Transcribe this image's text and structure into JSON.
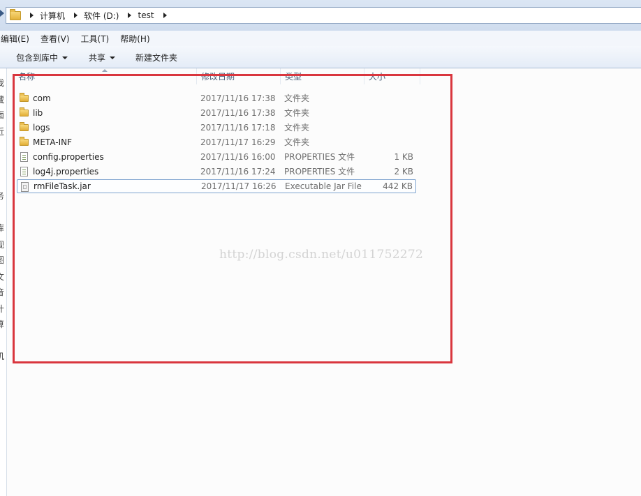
{
  "address": {
    "crumbs": [
      "计算机",
      "软件 (D:)",
      "test"
    ]
  },
  "menu": [
    "编辑(E)",
    "查看(V)",
    "工具(T)",
    "帮助(H)"
  ],
  "toolbar": {
    "include_library": "包含到库中",
    "share": "共享",
    "new_folder": "新建文件夹"
  },
  "left_pane_glyphs": [
    "我",
    "藏",
    "面",
    "近",
    "务",
    "库",
    "视",
    "图",
    "文",
    "音",
    "计",
    "算",
    "机"
  ],
  "columns": {
    "name": "名称",
    "date": "修改日期",
    "type": "类型",
    "size": "大小"
  },
  "files": [
    {
      "name": "com",
      "date": "2017/11/16 17:38",
      "type": "文件夹",
      "size": "",
      "icon": "folder-icon"
    },
    {
      "name": "lib",
      "date": "2017/11/16 17:38",
      "type": "文件夹",
      "size": "",
      "icon": "folder-icon"
    },
    {
      "name": "logs",
      "date": "2017/11/16 17:18",
      "type": "文件夹",
      "size": "",
      "icon": "folder-icon"
    },
    {
      "name": "META-INF",
      "date": "2017/11/17 16:29",
      "type": "文件夹",
      "size": "",
      "icon": "folder-icon"
    },
    {
      "name": "config.properties",
      "date": "2017/11/16 16:00",
      "type": "PROPERTIES 文件",
      "size": "1 KB",
      "icon": "properties-file-icon"
    },
    {
      "name": "log4j.properties",
      "date": "2017/11/16 17:24",
      "type": "PROPERTIES 文件",
      "size": "2 KB",
      "icon": "properties-file-icon"
    },
    {
      "name": "rmFileTask.jar",
      "date": "2017/11/17 16:26",
      "type": "Executable Jar File",
      "size": "442 KB",
      "icon": "jar-file-icon"
    }
  ],
  "watermark": "http://blog.csdn.net/u011752272",
  "colors": {
    "highlight": "#d9363e",
    "selection_border": "#7da2ce"
  }
}
